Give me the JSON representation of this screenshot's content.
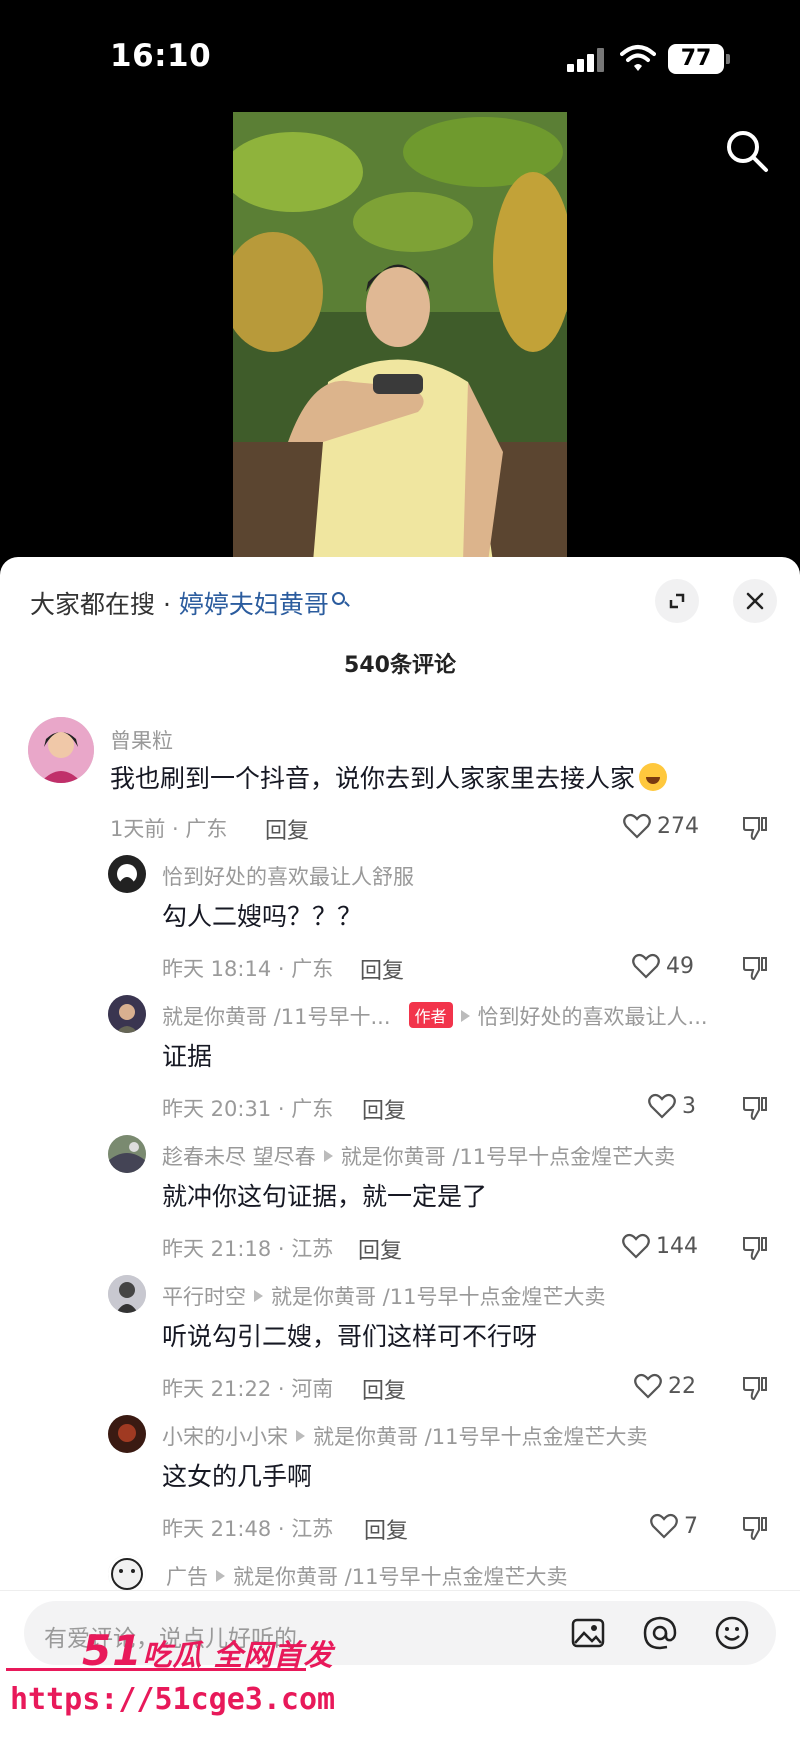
{
  "status_bar": {
    "time": "16:10",
    "battery": "77"
  },
  "panel": {
    "hot_search_prefix": "大家都在搜 · ",
    "hot_search_keyword": "婷婷夫妇黄哥",
    "comment_count": "540条评论"
  },
  "comments": [
    {
      "name": "曾果粒",
      "text": "我也刷到一个抖音，说你去到人家家里去接人家",
      "meta": "1天前 · 广东",
      "reply": "回复",
      "likes": "274"
    },
    {
      "name": "恰到好处的喜欢最让人舒服",
      "text": "勾人二嫂吗？？？",
      "meta": "昨天 18:14 · 广东",
      "reply": "回复",
      "likes": "49"
    },
    {
      "name": "就是你黄哥 /11号早十...",
      "tag": "作者",
      "reply_to": "恰到好处的喜欢最让人...",
      "text": "证据",
      "meta": "昨天 20:31 · 广东",
      "reply": "回复",
      "likes": "3"
    },
    {
      "name": "趁春未尽 望尽春",
      "reply_to": "就是你黄哥 /11号早十点金煌芒大卖",
      "text": "就冲你这句证据，就一定是了",
      "meta": "昨天 21:18 · 江苏",
      "reply": "回复",
      "likes": "144"
    },
    {
      "name": "平行时空",
      "reply_to": "就是你黄哥 /11号早十点金煌芒大卖",
      "text": "听说勾引二嫂，哥们这样可不行呀",
      "meta": "昨天 21:22 · 河南",
      "reply": "回复",
      "likes": "22"
    },
    {
      "name": "小宋的小小宋",
      "reply_to": "就是你黄哥 /11号早十点金煌芒大卖",
      "text": "这女的几手啊",
      "meta": "昨天 21:48 · 江苏",
      "reply": "回复",
      "likes": "7"
    },
    {
      "name": "广告",
      "reply_to": "就是你黄哥 /11号早十点金煌芒大卖"
    }
  ],
  "input": {
    "placeholder": "有爱评论，说点儿好听的"
  },
  "watermark": {
    "logo_num": "51",
    "logo_text": "吃瓜 全网首发",
    "url": "https://51cge3.com"
  }
}
